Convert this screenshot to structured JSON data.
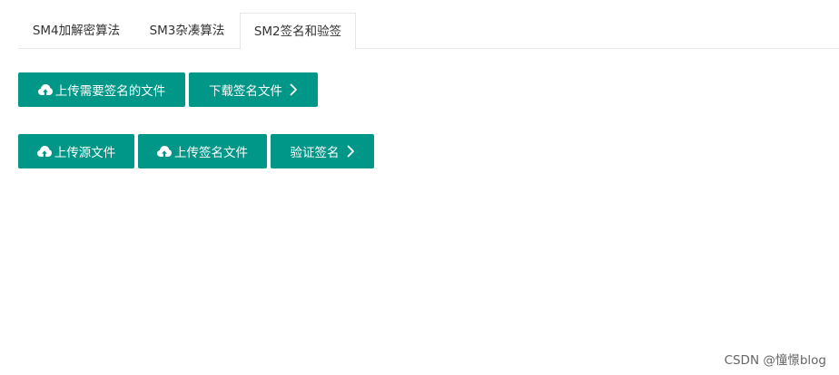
{
  "tabs": [
    {
      "label": "SM4加解密算法",
      "active": false
    },
    {
      "label": "SM3杂凑算法",
      "active": false
    },
    {
      "label": "SM2签名和验签",
      "active": true
    }
  ],
  "sign_row": {
    "upload_label": "上传需要签名的文件",
    "upload_icon": "cloud-upload-icon",
    "download_label": "下载签名文件",
    "download_icon": "chevron-right-icon"
  },
  "verify_row": {
    "upload_source_label": "上传源文件",
    "upload_signature_label": "上传签名文件",
    "verify_label": "验证签名",
    "upload_icon": "cloud-upload-icon",
    "verify_icon": "chevron-right-icon"
  },
  "watermark": "CSDN @憧憬blog",
  "colors": {
    "button_bg": "#009688",
    "button_text": "#ffffff",
    "tab_border": "#e6e6e6"
  }
}
